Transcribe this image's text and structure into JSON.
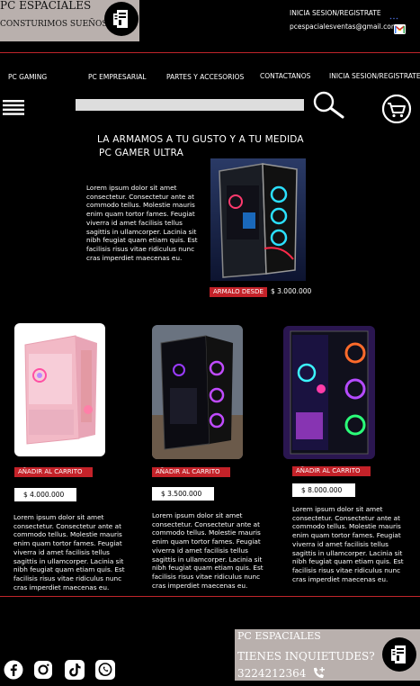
{
  "header": {
    "brand": "PC ESPACIALES",
    "slogan": "CONSTURIMOS SUEÑOS",
    "login_link": "INICIA SESION/REGISTRATE",
    "email": "pcespacialesventas@gmail.com"
  },
  "nav": {
    "items": [
      "PC GAMING",
      "PC EMPRESARIAL",
      "PARTES Y ACCESORIOS",
      "CONTACTANOS",
      "INICIA SESION/REGISTRATE"
    ]
  },
  "search": {
    "placeholder": ""
  },
  "hero": {
    "headline": "LA ARMAMOS A TU GUSTO Y A TU MEDIDA",
    "subheadline": "PC GAMER ULTRA",
    "description": "Lorem ipsum dolor sit amet consectetur. Consectetur ante at commodo tellus. Molestie mauris enim quam tortor fames. Feugiat viverra id amet facilisis tellus sagittis in ullamcorper. Lacinia sit nibh feugiat quam etiam quis. Est facilisis risus vitae ridiculus nunc cras imperdiet maecenas eu.",
    "cta": "ARMALO DESDE",
    "price": "$ 3.000.000"
  },
  "products": [
    {
      "cta": "AÑADIR AL CARRITO",
      "price": "$ 4.000.000",
      "description": "Lorem ipsum dolor sit amet consectetur. Consectetur ante at commodo tellus. Molestie mauris enim quam tortor fames. Feugiat viverra id amet facilisis tellus sagittis in ullamcorper. Lacinia sit nibh feugiat quam etiam quis. Est facilisis risus vitae ridiculus nunc cras imperdiet maecenas eu."
    },
    {
      "cta": "AÑADIR AL CARRITO",
      "price": "$ 3.500.000",
      "description": "Lorem ipsum dolor sit amet consectetur. Consectetur ante at commodo tellus. Molestie mauris enim quam tortor fames. Feugiat viverra id amet facilisis tellus sagittis in ullamcorper. Lacinia sit nibh feugiat quam etiam quis. Est facilisis risus vitae ridiculus nunc cras imperdiet maecenas eu."
    },
    {
      "cta": "AÑADIR AL CARRITO",
      "price": "$ 8.000.000",
      "description": "Lorem ipsum dolor sit amet consectetur. Consectetur ante at commodo tellus. Molestie mauris enim quam tortor fames. Feugiat viverra id amet facilisis tellus sagittis in ullamcorper. Lacinia sit nibh feugiat quam etiam quis. Est facilisis risus vitae ridiculus nunc cras imperdiet maecenas eu."
    }
  ],
  "footer": {
    "brand": "PC ESPACIALES",
    "question": "TIENES INQUIETUDES?",
    "phone": "3224212364"
  },
  "icons": {
    "social": [
      "facebook-icon",
      "instagram-icon",
      "tiktok-icon",
      "whatsapp-icon"
    ]
  },
  "colors": {
    "accent_red": "#c42229",
    "logo_box": "#b9b0ad",
    "background": "#000000"
  }
}
